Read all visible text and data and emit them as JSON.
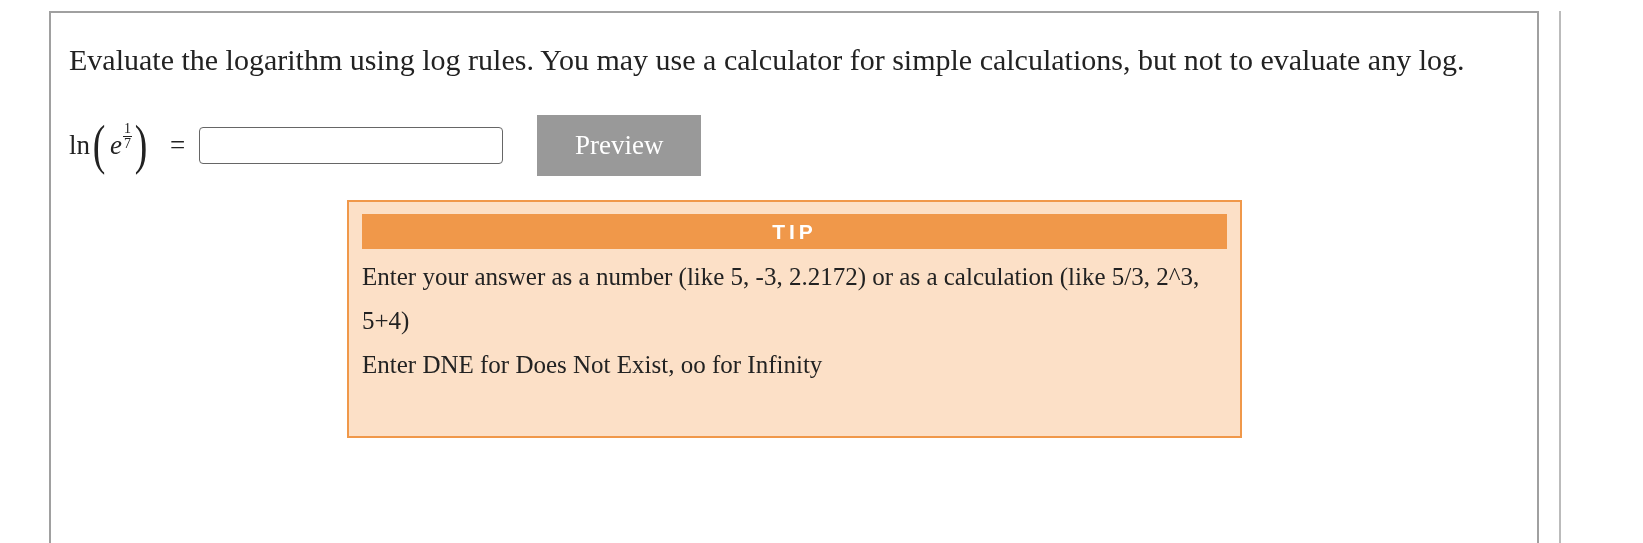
{
  "question": {
    "prompt": "Evaluate the logarithm using log rules. You may use a calculator for simple calculations, but not to evaluate any log.",
    "expression": {
      "function": "ln",
      "open_paren": "(",
      "base": "e",
      "exponent_numerator": "1",
      "exponent_denominator": "7",
      "close_paren": ")",
      "equals": "="
    },
    "preview_button": "Preview"
  },
  "tip": {
    "title": "TIP",
    "lines": [
      "Enter your answer as a number (like 5, -3, 2.2172) or as a calculation (like 5/3, 2^3, 5+4)",
      "Enter DNE for Does Not Exist, oo for Infinity"
    ]
  }
}
